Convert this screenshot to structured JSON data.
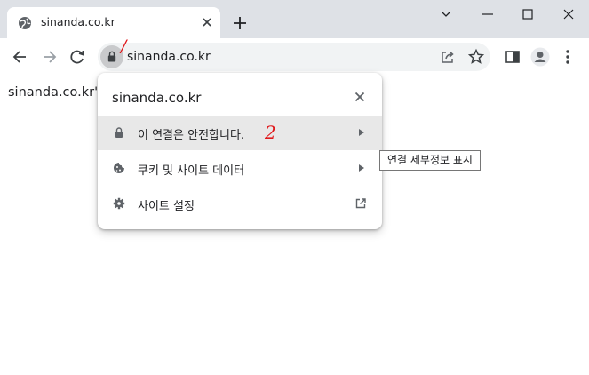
{
  "tab": {
    "title": "sinanda.co.kr"
  },
  "omnibox": {
    "url": "sinanda.co.kr"
  },
  "annotations": {
    "mark1": "/",
    "mark2": "2"
  },
  "page": {
    "text": "sinanda.co.kr's"
  },
  "popup": {
    "site": "sinanda.co.kr",
    "rows": [
      {
        "label": "이 연결은 안전합니다.",
        "icon": "lock-icon"
      },
      {
        "label": "쿠키 및 사이트 데이터",
        "icon": "cookie-icon"
      },
      {
        "label": "사이트 설정",
        "icon": "gear-icon"
      }
    ]
  },
  "tooltip": {
    "text": "연결 세부정보 표시"
  },
  "colors": {
    "titlebar": "#dee1e6",
    "annotation": "#e0191c",
    "highlight": "#e8e8e8"
  }
}
